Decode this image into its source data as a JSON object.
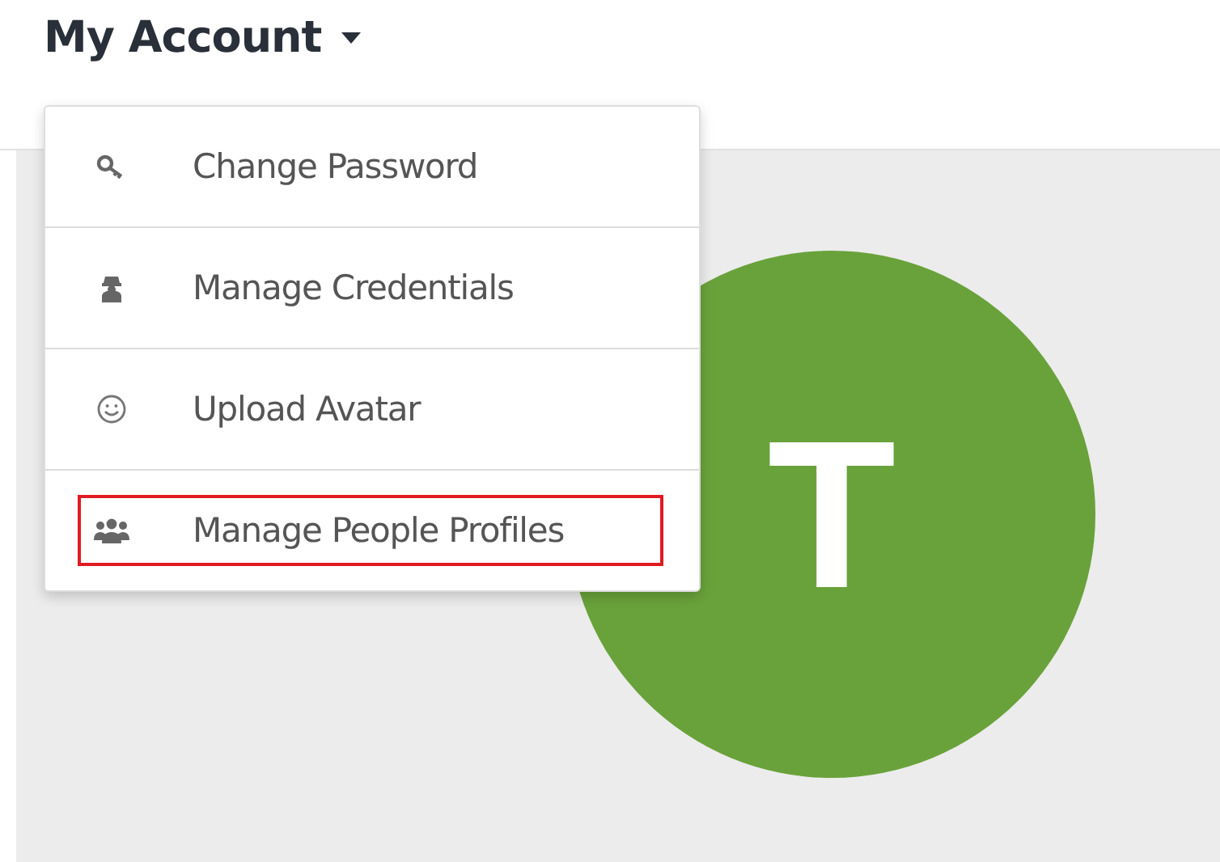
{
  "header": {
    "title": "My Account"
  },
  "menu": {
    "items": [
      {
        "label": "Change Password",
        "highlighted": false
      },
      {
        "label": "Manage Credentials",
        "highlighted": false
      },
      {
        "label": "Upload Avatar",
        "highlighted": false
      },
      {
        "label": "Manage People Profiles",
        "highlighted": true
      }
    ]
  },
  "avatar": {
    "initial": "T",
    "color": "#69a23a"
  }
}
